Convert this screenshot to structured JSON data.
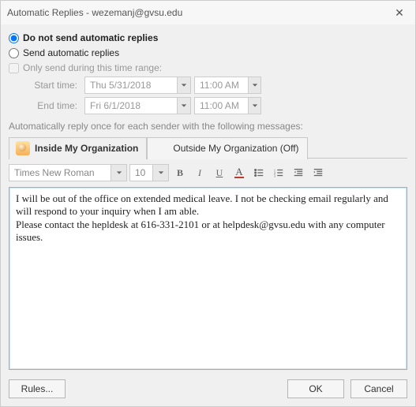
{
  "window": {
    "title": "Automatic Replies - wezemanj@gvsu.edu"
  },
  "options": {
    "do_not_send": "Do not send automatic replies",
    "send": "Send automatic replies",
    "only_during": "Only send during this time range:"
  },
  "time": {
    "start_label": "Start time:",
    "end_label": "End time:",
    "start_date": "Thu 5/31/2018",
    "start_time": "11:00 AM",
    "end_date": "Fri 6/1/2018",
    "end_time": "11:00 AM"
  },
  "section_label": "Automatically reply once for each sender with the following messages:",
  "tabs": {
    "inside": "Inside My Organization",
    "outside": "Outside My Organization (Off)"
  },
  "font": {
    "name": "Times New Roman",
    "size": "10"
  },
  "body_line1": "I will be out of the office on extended medical leave. I not be checking email regularly and will respond to your inquiry when I am able.",
  "body_line2": "Please contact the hepldesk at 616-331-2101 or at helpdesk@gvsu.edu with any computer issues.",
  "buttons": {
    "rules": "Rules...",
    "ok": "OK",
    "cancel": "Cancel"
  }
}
